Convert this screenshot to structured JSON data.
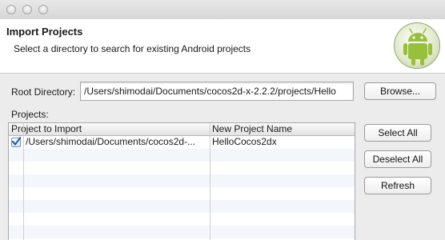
{
  "dialog": {
    "title": "Import Projects",
    "description": "Select a directory to search for existing Android projects",
    "logo_icon": "android-icon"
  },
  "root_directory": {
    "label": "Root Directory:",
    "value": "/Users/shimodai/Documents/cocos2d-x-2.2.2/projects/Hello",
    "browse_label": "Browse..."
  },
  "projects": {
    "label": "Projects:",
    "columns": [
      "Project to Import",
      "New Project Name"
    ],
    "rows": [
      {
        "checked": true,
        "path": "/Users/shimodai/Documents/cocos2d-...",
        "name": "HelloCocos2dx"
      }
    ]
  },
  "buttons": {
    "select_all": "Select All",
    "deselect_all": "Deselect All",
    "refresh": "Refresh"
  },
  "colors": {
    "android_green": "#97c03d",
    "check_blue": "#2a5fb0"
  }
}
